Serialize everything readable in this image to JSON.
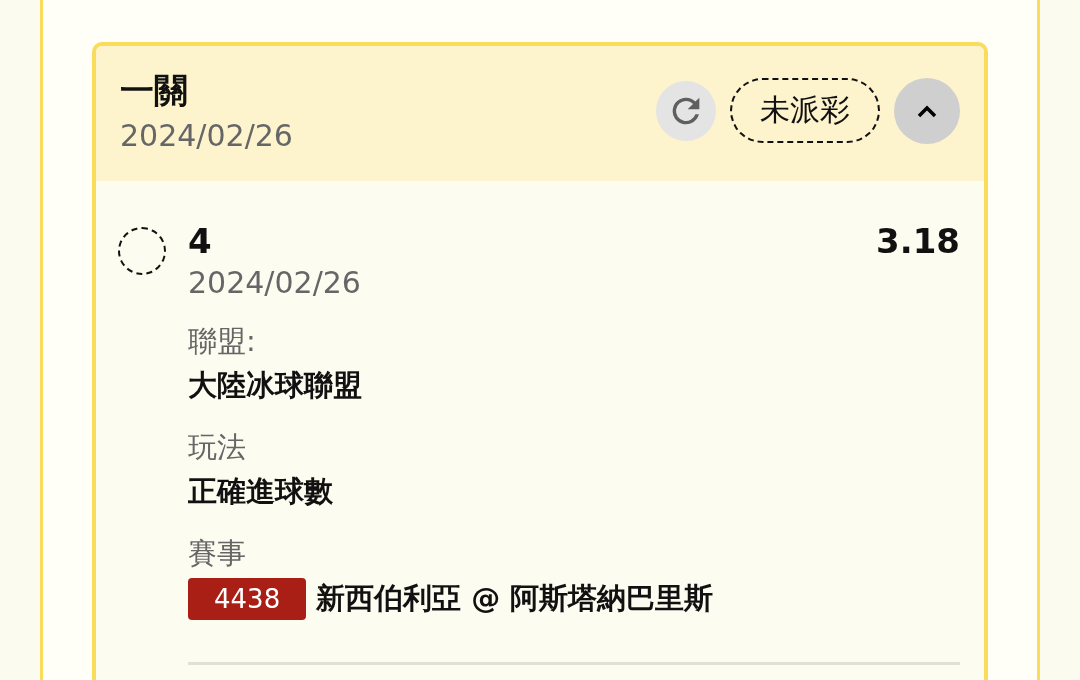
{
  "bet": {
    "title": "一關",
    "date": "2024/02/26",
    "status": "未派彩",
    "expanded": true,
    "selections": [
      {
        "selected": false,
        "name": "4",
        "date": "2024/02/26",
        "odds": "3.18",
        "details": [
          {
            "label": "聯盟:",
            "value": "大陸冰球聯盟"
          },
          {
            "label": "玩法",
            "value": "正確進球數"
          },
          {
            "label": "賽事",
            "match_no": "4438",
            "value": "新西伯利亞 @ 阿斯塔納巴里斯"
          }
        ]
      }
    ]
  }
}
